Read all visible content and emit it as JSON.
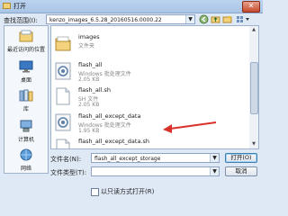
{
  "window": {
    "title": "打开",
    "close_symbol": "✕"
  },
  "toolbar": {
    "look_in_label": "查找范围(I):",
    "current_folder": "kenzo_images_6.5.28_20160516.0000.22"
  },
  "places": [
    {
      "label": "最近访问的位置",
      "icon": "recent-icon"
    },
    {
      "label": "桌面",
      "icon": "desktop-icon"
    },
    {
      "label": "库",
      "icon": "library-icon"
    },
    {
      "label": "计算机",
      "icon": "computer-icon"
    },
    {
      "label": "网络",
      "icon": "network-icon"
    }
  ],
  "files": [
    {
      "name": "images",
      "type": "文件夹",
      "size": "",
      "icon": "folder-icon"
    },
    {
      "name": "flash_all",
      "type": "Windows 批处理文件",
      "size": "2.05 KB",
      "icon": "batch-file-icon"
    },
    {
      "name": "flash_all.sh",
      "type": "SH 文件",
      "size": "2.05 KB",
      "icon": "text-file-icon"
    },
    {
      "name": "flash_all_except_data",
      "type": "Windows 批处理文件",
      "size": "1.95 KB",
      "icon": "batch-file-icon"
    },
    {
      "name": "flash_all_except_data.sh",
      "type": "",
      "size": "",
      "icon": "text-file-icon"
    }
  ],
  "form": {
    "filename_label": "文件名(N):",
    "filename_value": "flash_all_except_storage",
    "filetype_label": "文件类型(T):",
    "filetype_value": "",
    "open_button": "打开(O)",
    "cancel_button": "取消",
    "readonly_label": "以只读方式打开(R)"
  },
  "colors": {
    "arrow": "#d9322b",
    "folder": "#e9c46a"
  }
}
